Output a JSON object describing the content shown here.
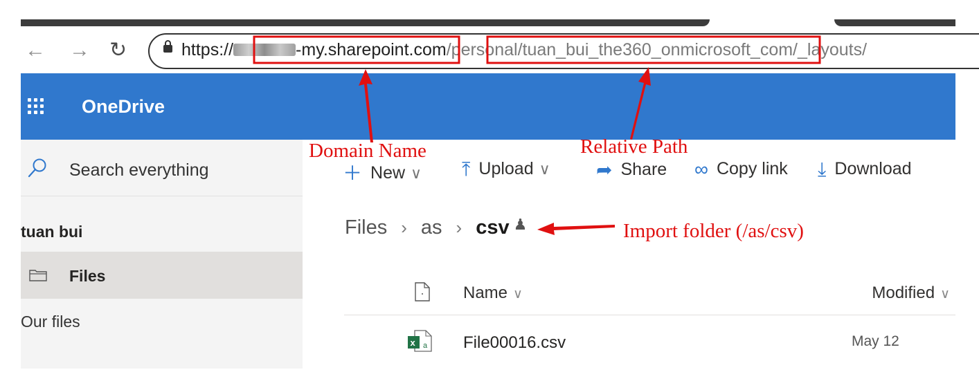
{
  "browser": {
    "back_icon": "arrow-left-icon",
    "forward_icon": "arrow-right-icon",
    "reload_icon": "reload-icon",
    "url_scheme": "https://",
    "url_domain_rest": "-my.sharepoint.com",
    "url_path": "/personal/tuan_bui_the360_onmicrosoft_com/_layouts/"
  },
  "suite": {
    "app_name": "OneDrive",
    "color": "#3078cd"
  },
  "nav": {
    "search_placeholder": "Search everything",
    "user_name": "tuan bui",
    "items": [
      {
        "label": "Files",
        "selected": true
      },
      {
        "label": "Our files"
      }
    ]
  },
  "commands": {
    "new": "New",
    "upload": "Upload",
    "share": "Share",
    "copy_link": "Copy link",
    "download": "Download"
  },
  "breadcrumb": {
    "items": [
      "Files",
      "as",
      "csv"
    ]
  },
  "file_list": {
    "columns": {
      "name": "Name",
      "modified": "Modified"
    },
    "rows": [
      {
        "name": "File00016.csv",
        "modified": "May 12"
      }
    ]
  },
  "annotations": {
    "domain_label": "Domain Name",
    "relative_path_label": "Relative Path",
    "import_folder_label": "Import folder (/as/csv)",
    "color": "#e01010"
  }
}
